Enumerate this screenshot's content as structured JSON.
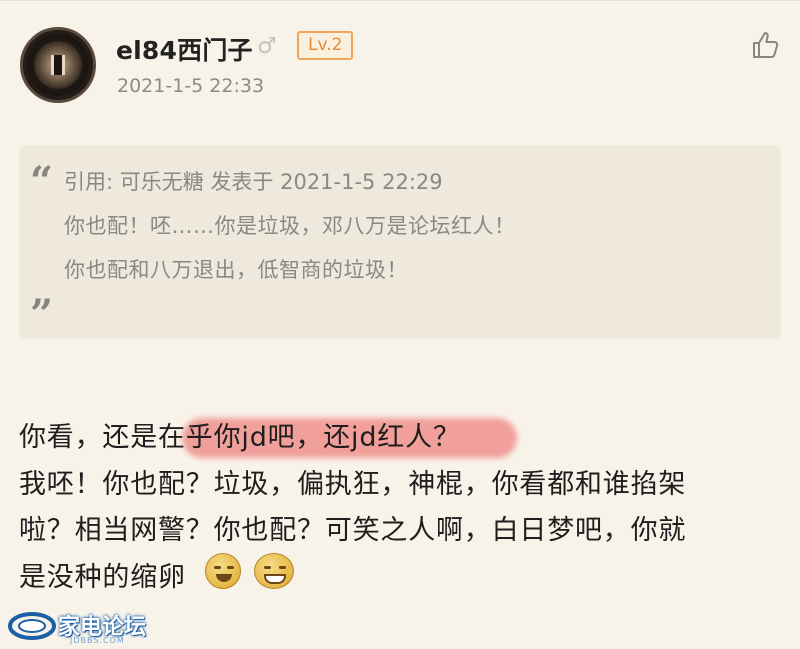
{
  "post": {
    "username": "el84西门子",
    "gender_icon": "♂",
    "level": "Lv.2",
    "time": "2021-1-5 22:33"
  },
  "quote": {
    "header": "引用: 可乐无糖 发表于 2021-1-5 22:29",
    "lines": [
      "你也配！呸……你是垃圾，邓八万是论坛红人！",
      "你也配和八万退出，低智商的垃圾！"
    ]
  },
  "body": {
    "lines": [
      "你看，还是在乎你jd吧，还jd红人？",
      "我呸！你也配？垃圾，偏执狂，神棍，你看都和谁掐架",
      "啦？相当网警？你也配？可笑之人啊，白日梦吧，你就",
      "是没种的缩卵"
    ]
  },
  "watermark": {
    "text": "家电论坛",
    "sub": "JDBBS.COM"
  },
  "colors": {
    "background": "#f8f3e9",
    "quote_bg": "#efe9dd",
    "level_accent": "#e98933",
    "highlight": "#eb5a5a",
    "watermark_blue": "#1b5fa6"
  },
  "icons": [
    "avatar",
    "male-gender-icon",
    "thumbs-up-icon",
    "quote-open-icon",
    "quote-close-icon",
    "laugh-emoji-icon",
    "grin-emoji-icon",
    "site-logo-icon"
  ]
}
